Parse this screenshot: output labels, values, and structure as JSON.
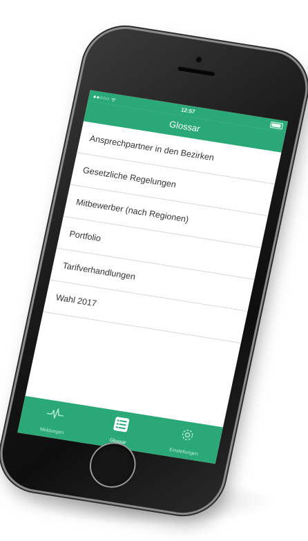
{
  "status_bar": {
    "carrier": "●●○○○ ᯤ",
    "time": "12:57"
  },
  "nav": {
    "title": "Glossar"
  },
  "list": {
    "items": [
      "Ansprechpartner in den Bezirken",
      "Gesetzliche Regelungen",
      "Mitbewerber (nach Regionen)",
      "Portfolio",
      "Tarifverhandlungen",
      "Wahl 2017"
    ]
  },
  "tabs": [
    {
      "label": "Meldungen",
      "icon": "pulse-icon"
    },
    {
      "label": "Glossar",
      "icon": "list-icon"
    },
    {
      "label": "Einstellungen",
      "icon": "gear-icon"
    }
  ],
  "colors": {
    "accent": "#2aa877"
  }
}
